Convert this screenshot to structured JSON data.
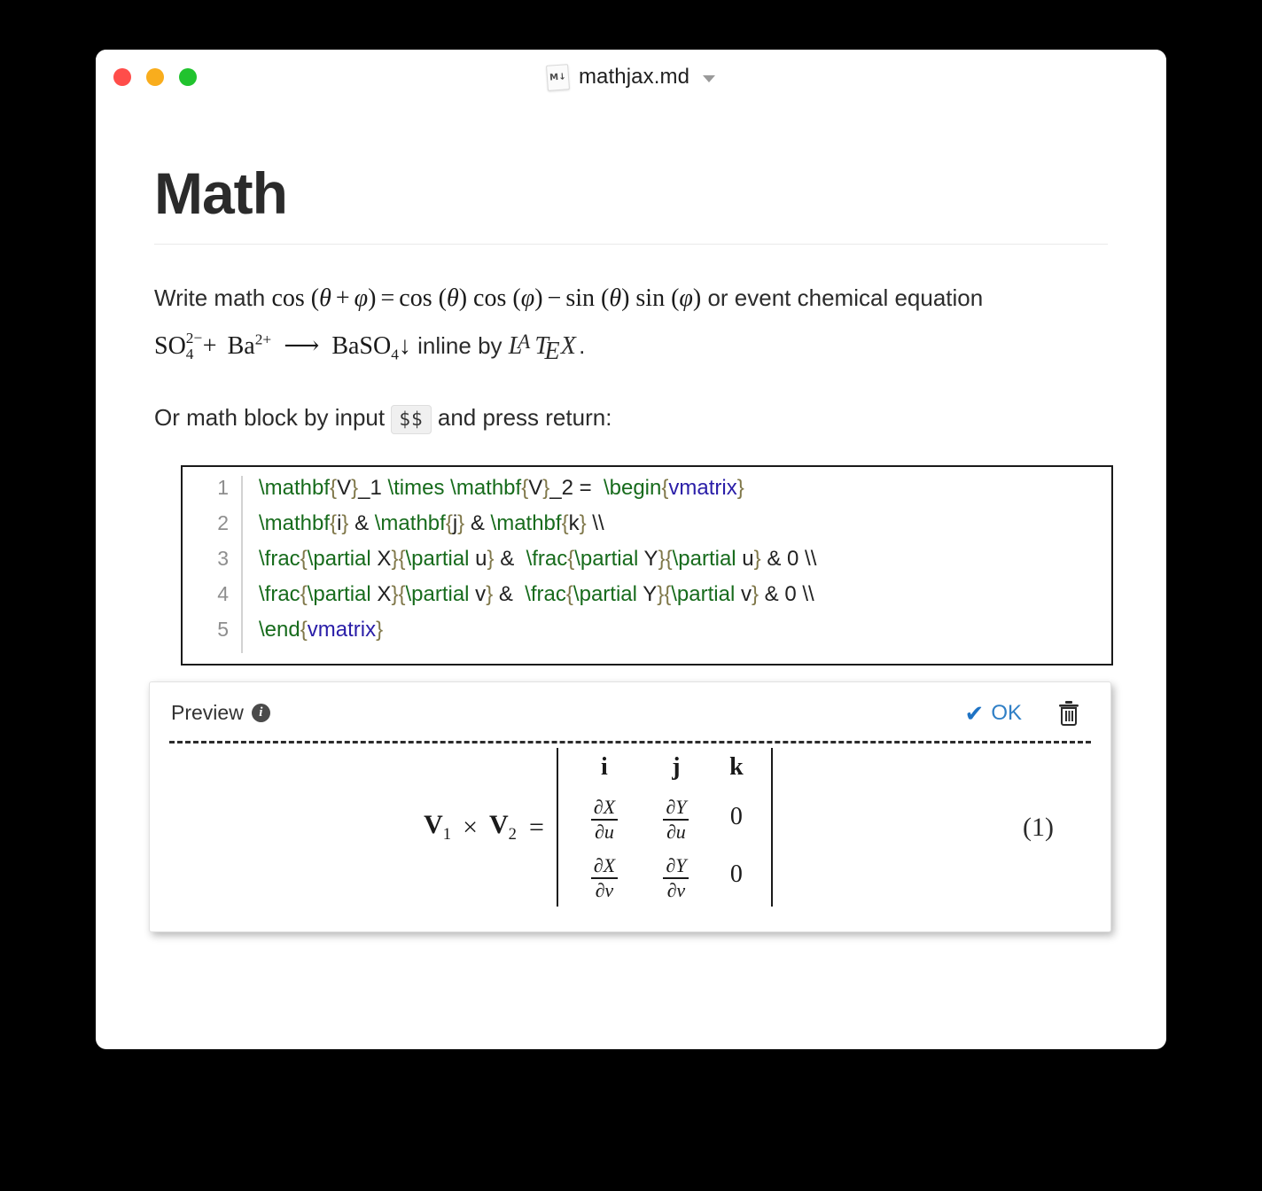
{
  "window": {
    "traffic_lights": [
      {
        "name": "close",
        "color": "#ff4d4a"
      },
      {
        "name": "minimize",
        "color": "#f9ad1d"
      },
      {
        "name": "zoom",
        "color": "#21c32e"
      }
    ],
    "file_icon_label": "M↓",
    "title": "mathjax.md",
    "title_chevron": "chevron-down"
  },
  "document": {
    "heading": "Math",
    "paragraph1": {
      "lead": "Write math ",
      "formula": "cos (θ + φ) = cos (θ) cos (φ) − sin (θ) sin (φ)",
      "formula_parts": {
        "cos1": "cos",
        "theta": "θ",
        "plus": "+",
        "phi": "φ",
        "equals": "=",
        "minus": "−",
        "sin": "sin"
      },
      "mid": " or event chemical equation ",
      "chem": {
        "so4": "SO",
        "so4_sup": "2−",
        "so4_sub": "4",
        "plus": "+",
        "ba": "Ba",
        "ba_sup": "2+",
        "arrow": "⟶",
        "baso4": "BaSO",
        "baso4_sub": "4",
        "precipitate": "↓"
      },
      "tail": " inline by ",
      "latex": {
        "l": "L",
        "a": "A",
        "t": "T",
        "e": "E",
        "x": "X"
      },
      "period": "."
    },
    "paragraph2": {
      "before": "Or math block by input ",
      "code_chip": "$$",
      "after": " and press return:"
    }
  },
  "code_editor": {
    "lines": [
      {
        "number": "1",
        "tokens": [
          {
            "text": "\\mathbf",
            "type": "cmd"
          },
          {
            "text": "{",
            "type": "brace"
          },
          {
            "text": "V",
            "type": "txt"
          },
          {
            "text": "}",
            "type": "brace"
          },
          {
            "text": "_1 ",
            "type": "txt"
          },
          {
            "text": "\\times",
            "type": "cmd"
          },
          {
            "text": " ",
            "type": "txt"
          },
          {
            "text": "\\mathbf",
            "type": "cmd"
          },
          {
            "text": "{",
            "type": "brace"
          },
          {
            "text": "V",
            "type": "txt"
          },
          {
            "text": "}",
            "type": "brace"
          },
          {
            "text": "_2 =  ",
            "type": "txt"
          },
          {
            "text": "\\begin",
            "type": "cmd"
          },
          {
            "text": "{",
            "type": "brace"
          },
          {
            "text": "vmatrix",
            "type": "env"
          },
          {
            "text": "}",
            "type": "brace"
          }
        ]
      },
      {
        "number": "2",
        "tokens": [
          {
            "text": "\\mathbf",
            "type": "cmd"
          },
          {
            "text": "{",
            "type": "brace"
          },
          {
            "text": "i",
            "type": "txt"
          },
          {
            "text": "}",
            "type": "brace"
          },
          {
            "text": " & ",
            "type": "txt"
          },
          {
            "text": "\\mathbf",
            "type": "cmd"
          },
          {
            "text": "{",
            "type": "brace"
          },
          {
            "text": "j",
            "type": "txt"
          },
          {
            "text": "}",
            "type": "brace"
          },
          {
            "text": " & ",
            "type": "txt"
          },
          {
            "text": "\\mathbf",
            "type": "cmd"
          },
          {
            "text": "{",
            "type": "brace"
          },
          {
            "text": "k",
            "type": "txt"
          },
          {
            "text": "}",
            "type": "brace"
          },
          {
            "text": " \\\\",
            "type": "txt"
          }
        ]
      },
      {
        "number": "3",
        "tokens": [
          {
            "text": "\\frac",
            "type": "cmd"
          },
          {
            "text": "{",
            "type": "brace"
          },
          {
            "text": "\\partial",
            "type": "cmd"
          },
          {
            "text": " X",
            "type": "txt"
          },
          {
            "text": "}",
            "type": "brace"
          },
          {
            "text": "{",
            "type": "brace"
          },
          {
            "text": "\\partial",
            "type": "cmd"
          },
          {
            "text": " u",
            "type": "txt"
          },
          {
            "text": "}",
            "type": "brace"
          },
          {
            "text": " &  ",
            "type": "txt"
          },
          {
            "text": "\\frac",
            "type": "cmd"
          },
          {
            "text": "{",
            "type": "brace"
          },
          {
            "text": "\\partial",
            "type": "cmd"
          },
          {
            "text": " Y",
            "type": "txt"
          },
          {
            "text": "}",
            "type": "brace"
          },
          {
            "text": "{",
            "type": "brace"
          },
          {
            "text": "\\partial",
            "type": "cmd"
          },
          {
            "text": " u",
            "type": "txt"
          },
          {
            "text": "}",
            "type": "brace"
          },
          {
            "text": " & 0 \\\\",
            "type": "txt"
          }
        ]
      },
      {
        "number": "4",
        "tokens": [
          {
            "text": "\\frac",
            "type": "cmd"
          },
          {
            "text": "{",
            "type": "brace"
          },
          {
            "text": "\\partial",
            "type": "cmd"
          },
          {
            "text": " X",
            "type": "txt"
          },
          {
            "text": "}",
            "type": "brace"
          },
          {
            "text": "{",
            "type": "brace"
          },
          {
            "text": "\\partial",
            "type": "cmd"
          },
          {
            "text": " v",
            "type": "txt"
          },
          {
            "text": "}",
            "type": "brace"
          },
          {
            "text": " &  ",
            "type": "txt"
          },
          {
            "text": "\\frac",
            "type": "cmd"
          },
          {
            "text": "{",
            "type": "brace"
          },
          {
            "text": "\\partial",
            "type": "cmd"
          },
          {
            "text": " Y",
            "type": "txt"
          },
          {
            "text": "}",
            "type": "brace"
          },
          {
            "text": "{",
            "type": "brace"
          },
          {
            "text": "\\partial",
            "type": "cmd"
          },
          {
            "text": " v",
            "type": "txt"
          },
          {
            "text": "}",
            "type": "brace"
          },
          {
            "text": " & 0 \\\\",
            "type": "txt"
          }
        ]
      },
      {
        "number": "5",
        "tokens": [
          {
            "text": "\\end",
            "type": "cmd"
          },
          {
            "text": "{",
            "type": "brace"
          },
          {
            "text": "vmatrix",
            "type": "env"
          },
          {
            "text": "}",
            "type": "brace"
          }
        ]
      }
    ],
    "colors": {
      "command": "#176b1c",
      "brace": "#80784a",
      "environment": "#2a1ea8",
      "plain": "#222222",
      "line_number": "#8e8e8e",
      "border": "#1a1a1a"
    }
  },
  "preview": {
    "label": "Preview",
    "info_glyph": "i",
    "ok_label": "OK",
    "ok_color": "#2f7fc6",
    "check_glyph": "✔",
    "trash_name": "trash-icon",
    "equation": {
      "lhs_v1": "V",
      "lhs_v1_sub": "1",
      "times": "×",
      "lhs_v2": "V",
      "lhs_v2_sub": "2",
      "equals": "=",
      "matrix": [
        [
          "i",
          "j",
          "k"
        ],
        [
          {
            "num": "∂X",
            "den": "∂u"
          },
          {
            "num": "∂Y",
            "den": "∂u"
          },
          "0"
        ],
        [
          {
            "num": "∂X",
            "den": "∂v"
          },
          {
            "num": "∂Y",
            "den": "∂v"
          },
          "0"
        ]
      ],
      "number": "(1)"
    }
  }
}
